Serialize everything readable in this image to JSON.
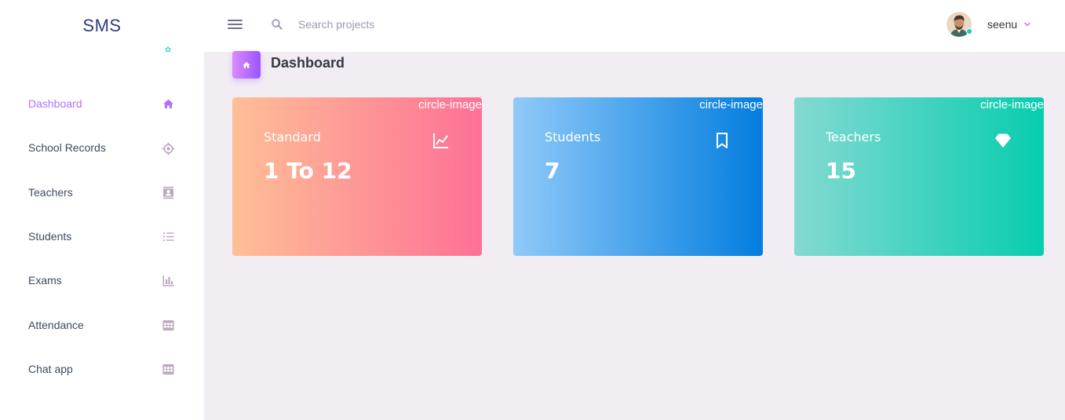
{
  "brand": {
    "name": "SMS"
  },
  "search": {
    "placeholder": "Search projects"
  },
  "user": {
    "name": "seenu"
  },
  "sidebar": {
    "items": [
      {
        "label": "Dashboard",
        "icon": "home-icon",
        "active": true
      },
      {
        "label": "School Records",
        "icon": "crosshairs-icon",
        "active": false
      },
      {
        "label": "Teachers",
        "icon": "contacts-icon",
        "active": false
      },
      {
        "label": "Students",
        "icon": "format-list-bulleted-icon",
        "active": false
      },
      {
        "label": "Exams",
        "icon": "chart-bar-icon",
        "active": false
      },
      {
        "label": "Attendance",
        "icon": "table-large-icon",
        "active": false
      },
      {
        "label": "Chat app",
        "icon": "table-large-icon",
        "active": false
      }
    ]
  },
  "page": {
    "title": "Dashboard"
  },
  "cards": [
    {
      "label": "Standard",
      "value": "1 To 12",
      "overlay": "circle-image",
      "icon": "chart-line-icon"
    },
    {
      "label": "Students",
      "value": "7",
      "overlay": "circle-image",
      "icon": "bookmark-outline-icon"
    },
    {
      "label": "Teachers",
      "value": "15",
      "overlay": "circle-image",
      "icon": "diamond-icon"
    }
  ],
  "colors": {
    "accent": "#b66dff",
    "sidebar_icon": "#bba8bff5",
    "content_bg": "#f2edf3",
    "brand_text": "#2e3b7c",
    "online": "#1bcfb4"
  }
}
